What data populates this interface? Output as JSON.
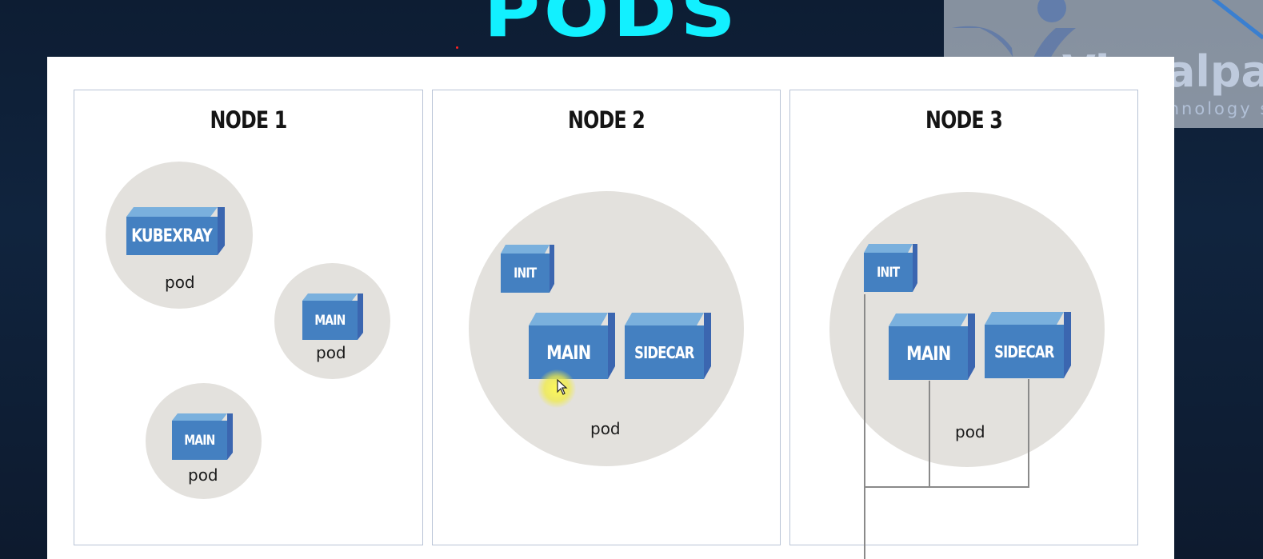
{
  "title": "PODS",
  "watermark": {
    "name": "Visualpa",
    "tagline": "A technology s"
  },
  "nodes": [
    {
      "title": "NODE 1",
      "pods": [
        {
          "containers": [
            "KUBEXRAY"
          ],
          "label": "pod"
        },
        {
          "containers": [
            "MAIN"
          ],
          "label": "pod"
        },
        {
          "containers": [
            "MAIN"
          ],
          "label": "pod"
        }
      ]
    },
    {
      "title": "NODE 2",
      "pods": [
        {
          "containers": [
            "INIT",
            "MAIN",
            "SIDECAR"
          ],
          "label": "pod"
        }
      ]
    },
    {
      "title": "NODE 3",
      "pods": [
        {
          "containers": [
            "INIT",
            "MAIN",
            "SIDECAR"
          ],
          "label": "pod"
        }
      ]
    }
  ],
  "colors": {
    "title": "#12f0ff",
    "background": "#0f2038",
    "container_face": "#4480c1",
    "container_top": "#7ab0dd",
    "container_side": "#3b66b0",
    "pod_fill": "#e3e1dd",
    "cursor_highlight": "#f5f050"
  },
  "icons": [
    "mouse-cursor-icon",
    "visualpath-logo-icon"
  ]
}
